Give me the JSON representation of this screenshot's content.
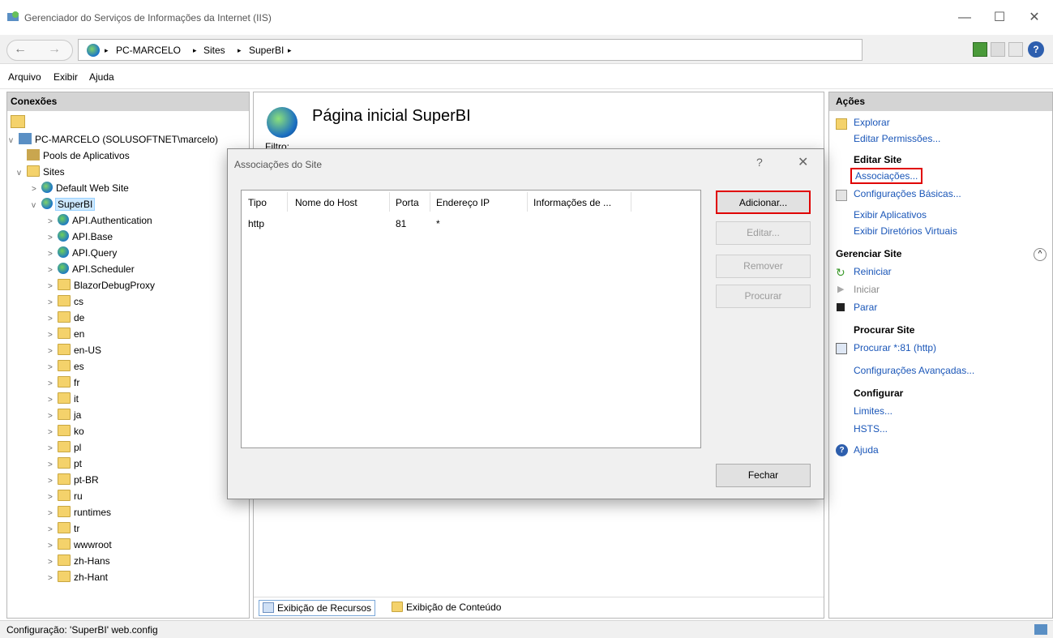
{
  "window": {
    "title": "Gerenciador do Serviços de Informações da Internet (IIS)",
    "controls": [
      "—",
      "☐",
      "✕"
    ]
  },
  "address": {
    "crumbs": [
      "PC-MARCELO",
      "Sites",
      "SuperBI"
    ],
    "separator": "▸"
  },
  "menu": [
    "Arquivo",
    "Exibir",
    "Ajuda"
  ],
  "connections": {
    "header": "Conexões",
    "server": "PC-MARCELO (SOLUSOFTNET\\marcelo)",
    "app_pools": "Pools de Aplicativos",
    "sites": "Sites",
    "default_site": "Default Web Site",
    "selected_site": "SuperBI",
    "apps": [
      "API.Authentication",
      "API.Base",
      "API.Query",
      "API.Scheduler"
    ],
    "folders": [
      "BlazorDebugProxy",
      "cs",
      "de",
      "en",
      "en-US",
      "es",
      "fr",
      "it",
      "ja",
      "ko",
      "pl",
      "pt",
      "pt-BR",
      "ru",
      "runtimes",
      "tr",
      "wwwroot",
      "zh-Hans",
      "zh-Hant"
    ]
  },
  "center": {
    "title": "Página inicial SuperBI",
    "filter_label": "Filtro:",
    "tab_features": "Exibição de Recursos",
    "tab_content": "Exibição de Conteúdo"
  },
  "dialog": {
    "title": "Associações do Site",
    "help": "?",
    "close": "✕",
    "columns": [
      "Tipo",
      "Nome do Host",
      "Porta",
      "Endereço IP",
      "Informações de ..."
    ],
    "rows": [
      {
        "tipo": "http",
        "host": "",
        "porta": "81",
        "ip": "*",
        "info": ""
      }
    ],
    "buttons": {
      "add": "Adicionar...",
      "edit": "Editar...",
      "remove": "Remover",
      "browse": "Procurar",
      "close": "Fechar"
    }
  },
  "actions": {
    "header": "Ações",
    "explore": "Explorar",
    "edit_permissions": "Editar Permissões...",
    "edit_site_group": "Editar Site",
    "bindings": "Associações...",
    "basic_settings": "Configurações Básicas...",
    "view_apps": "Exibir Aplicativos",
    "view_vdirs": "Exibir Diretórios Virtuais",
    "manage_site_group": "Gerenciar Site",
    "restart": "Reiniciar",
    "start": "Iniciar",
    "stop": "Parar",
    "browse_site_group": "Procurar Site",
    "browse_link": "Procurar *:81 (http)",
    "advanced_settings": "Configurações Avançadas...",
    "configure_group": "Configurar",
    "limits": "Limites...",
    "hsts": "HSTS...",
    "help": "Ajuda"
  },
  "status": {
    "text": "Configuração: 'SuperBI' web.config"
  },
  "colors": {
    "accent_link": "#1a56b8",
    "highlight_red": "#e00000",
    "selection": "#cce8ff"
  }
}
